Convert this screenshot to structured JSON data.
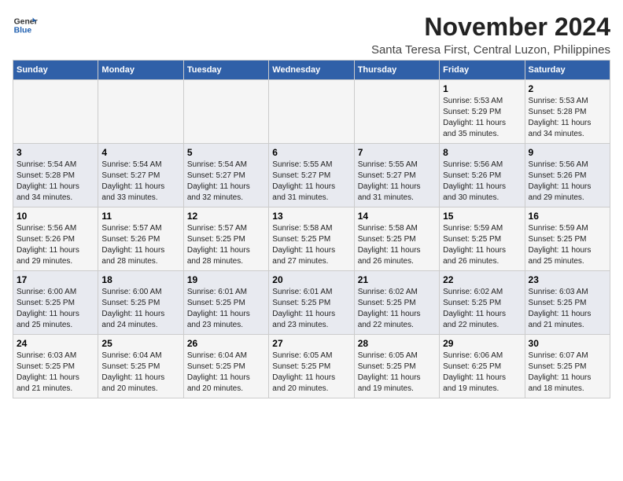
{
  "header": {
    "logo_line1": "General",
    "logo_line2": "Blue",
    "title": "November 2024",
    "subtitle": "Santa Teresa First, Central Luzon, Philippines"
  },
  "weekdays": [
    "Sunday",
    "Monday",
    "Tuesday",
    "Wednesday",
    "Thursday",
    "Friday",
    "Saturday"
  ],
  "weeks": [
    [
      {
        "day": "",
        "info": ""
      },
      {
        "day": "",
        "info": ""
      },
      {
        "day": "",
        "info": ""
      },
      {
        "day": "",
        "info": ""
      },
      {
        "day": "",
        "info": ""
      },
      {
        "day": "1",
        "info": "Sunrise: 5:53 AM\nSunset: 5:29 PM\nDaylight: 11 hours\nand 35 minutes."
      },
      {
        "day": "2",
        "info": "Sunrise: 5:53 AM\nSunset: 5:28 PM\nDaylight: 11 hours\nand 34 minutes."
      }
    ],
    [
      {
        "day": "3",
        "info": "Sunrise: 5:54 AM\nSunset: 5:28 PM\nDaylight: 11 hours\nand 34 minutes."
      },
      {
        "day": "4",
        "info": "Sunrise: 5:54 AM\nSunset: 5:27 PM\nDaylight: 11 hours\nand 33 minutes."
      },
      {
        "day": "5",
        "info": "Sunrise: 5:54 AM\nSunset: 5:27 PM\nDaylight: 11 hours\nand 32 minutes."
      },
      {
        "day": "6",
        "info": "Sunrise: 5:55 AM\nSunset: 5:27 PM\nDaylight: 11 hours\nand 31 minutes."
      },
      {
        "day": "7",
        "info": "Sunrise: 5:55 AM\nSunset: 5:27 PM\nDaylight: 11 hours\nand 31 minutes."
      },
      {
        "day": "8",
        "info": "Sunrise: 5:56 AM\nSunset: 5:26 PM\nDaylight: 11 hours\nand 30 minutes."
      },
      {
        "day": "9",
        "info": "Sunrise: 5:56 AM\nSunset: 5:26 PM\nDaylight: 11 hours\nand 29 minutes."
      }
    ],
    [
      {
        "day": "10",
        "info": "Sunrise: 5:56 AM\nSunset: 5:26 PM\nDaylight: 11 hours\nand 29 minutes."
      },
      {
        "day": "11",
        "info": "Sunrise: 5:57 AM\nSunset: 5:26 PM\nDaylight: 11 hours\nand 28 minutes."
      },
      {
        "day": "12",
        "info": "Sunrise: 5:57 AM\nSunset: 5:25 PM\nDaylight: 11 hours\nand 28 minutes."
      },
      {
        "day": "13",
        "info": "Sunrise: 5:58 AM\nSunset: 5:25 PM\nDaylight: 11 hours\nand 27 minutes."
      },
      {
        "day": "14",
        "info": "Sunrise: 5:58 AM\nSunset: 5:25 PM\nDaylight: 11 hours\nand 26 minutes."
      },
      {
        "day": "15",
        "info": "Sunrise: 5:59 AM\nSunset: 5:25 PM\nDaylight: 11 hours\nand 26 minutes."
      },
      {
        "day": "16",
        "info": "Sunrise: 5:59 AM\nSunset: 5:25 PM\nDaylight: 11 hours\nand 25 minutes."
      }
    ],
    [
      {
        "day": "17",
        "info": "Sunrise: 6:00 AM\nSunset: 5:25 PM\nDaylight: 11 hours\nand 25 minutes."
      },
      {
        "day": "18",
        "info": "Sunrise: 6:00 AM\nSunset: 5:25 PM\nDaylight: 11 hours\nand 24 minutes."
      },
      {
        "day": "19",
        "info": "Sunrise: 6:01 AM\nSunset: 5:25 PM\nDaylight: 11 hours\nand 23 minutes."
      },
      {
        "day": "20",
        "info": "Sunrise: 6:01 AM\nSunset: 5:25 PM\nDaylight: 11 hours\nand 23 minutes."
      },
      {
        "day": "21",
        "info": "Sunrise: 6:02 AM\nSunset: 5:25 PM\nDaylight: 11 hours\nand 22 minutes."
      },
      {
        "day": "22",
        "info": "Sunrise: 6:02 AM\nSunset: 5:25 PM\nDaylight: 11 hours\nand 22 minutes."
      },
      {
        "day": "23",
        "info": "Sunrise: 6:03 AM\nSunset: 5:25 PM\nDaylight: 11 hours\nand 21 minutes."
      }
    ],
    [
      {
        "day": "24",
        "info": "Sunrise: 6:03 AM\nSunset: 5:25 PM\nDaylight: 11 hours\nand 21 minutes."
      },
      {
        "day": "25",
        "info": "Sunrise: 6:04 AM\nSunset: 5:25 PM\nDaylight: 11 hours\nand 20 minutes."
      },
      {
        "day": "26",
        "info": "Sunrise: 6:04 AM\nSunset: 5:25 PM\nDaylight: 11 hours\nand 20 minutes."
      },
      {
        "day": "27",
        "info": "Sunrise: 6:05 AM\nSunset: 5:25 PM\nDaylight: 11 hours\nand 20 minutes."
      },
      {
        "day": "28",
        "info": "Sunrise: 6:05 AM\nSunset: 5:25 PM\nDaylight: 11 hours\nand 19 minutes."
      },
      {
        "day": "29",
        "info": "Sunrise: 6:06 AM\nSunset: 6:25 PM\nDaylight: 11 hours\nand 19 minutes."
      },
      {
        "day": "30",
        "info": "Sunrise: 6:07 AM\nSunset: 5:25 PM\nDaylight: 11 hours\nand 18 minutes."
      }
    ]
  ]
}
